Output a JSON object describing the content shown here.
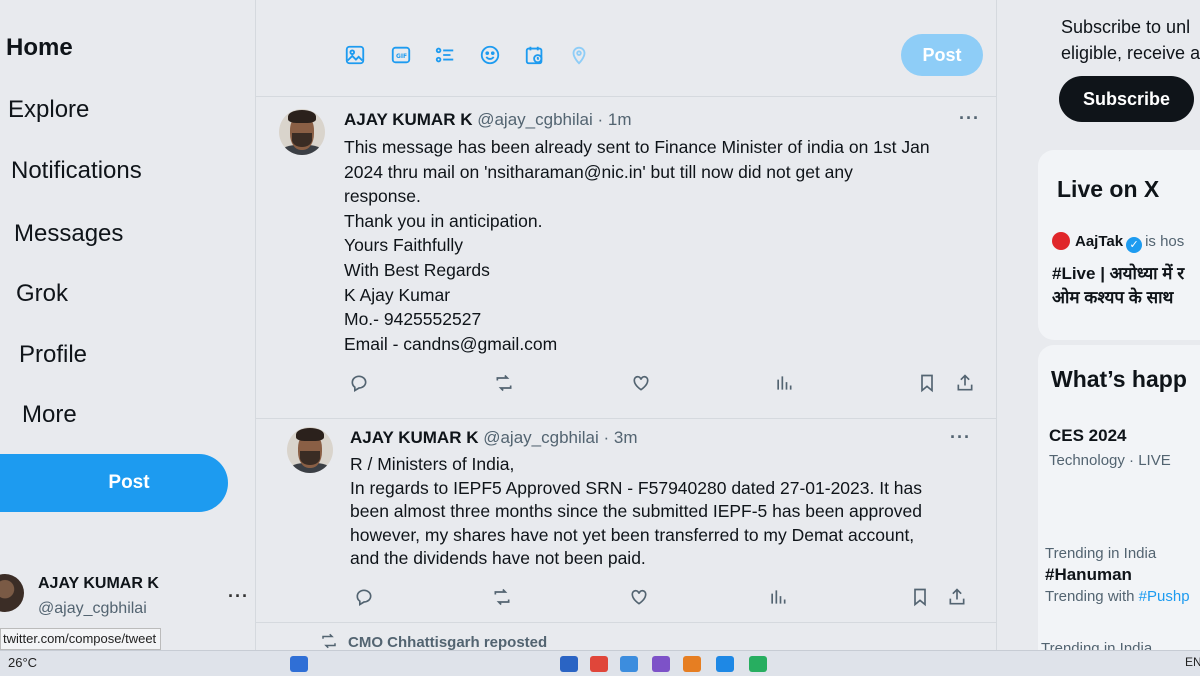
{
  "sidebar": {
    "nav": [
      "Home",
      "Explore",
      "Notifications",
      "Messages",
      "Grok",
      "Profile",
      "More"
    ],
    "post_label": "Post",
    "account": {
      "name": "AJAY KUMAR K",
      "handle": "@ajay_cgbhilai",
      "more": "···"
    },
    "status_url": "twitter.com/compose/tweet"
  },
  "composer": {
    "icons": [
      "image-icon",
      "gif-icon",
      "poll-icon",
      "emoji-icon",
      "schedule-icon",
      "location-icon"
    ],
    "post_label": "Post"
  },
  "tweets": [
    {
      "name": "AJAY KUMAR K",
      "handle": "@ajay_cgbhilai",
      "time": "· 1m",
      "more": "···",
      "lines": [
        "This message has been already sent to Finance Minister of india on 1st Jan",
        "2024 thru mail on 'nsitharaman@nic.in' but till now did not get any",
        "response.",
        "Thank you in anticipation.",
        "Yours Faithfully",
        "With Best Regards",
        "K Ajay Kumar",
        "Mo.- 9425552527",
        "Email - candns@gmail.com"
      ]
    },
    {
      "name": "AJAY KUMAR K",
      "handle": "@ajay_cgbhilai",
      "time": "· 3m",
      "more": "···",
      "lines": [
        "R / Ministers of India,",
        "In regards to IEPF5 Approved SRN - F57940280 dated 27-01-2023.  It has",
        "been almost three months since the submitted IEPF-5 has been approved",
        "however, my shares have not yet been transferred to my Demat account,",
        "and the dividends have not been paid."
      ]
    }
  ],
  "repost_notice": "CMO Chhattisgarh reposted",
  "right": {
    "subscribe_text_1": "Subscribe to unl",
    "subscribe_text_2": "eligible, receive a",
    "subscribe_label": "Subscribe",
    "live_title": "Live on X",
    "live_account": "AajTak",
    "live_suffix": "is hos",
    "live_text_1": "#Live | अयोध्या में र",
    "live_text_2": "ओम कश्यप के साथ",
    "happening_title": "What’s happ",
    "trends": [
      {
        "title": "CES 2024",
        "meta": "Technology · LIVE"
      },
      {
        "meta_top": "Trending in India",
        "title": "#Hanuman",
        "meta": "Trending with ",
        "link": "#Pushp"
      },
      {
        "meta_top": "Trending in India"
      }
    ]
  },
  "taskbar": {
    "temperature": "26°C",
    "lang": "EN"
  },
  "colors": {
    "accent": "#1d9bf0",
    "accent_disabled": "#8ecdf7",
    "text": "#0f1419",
    "muted": "#536471"
  }
}
